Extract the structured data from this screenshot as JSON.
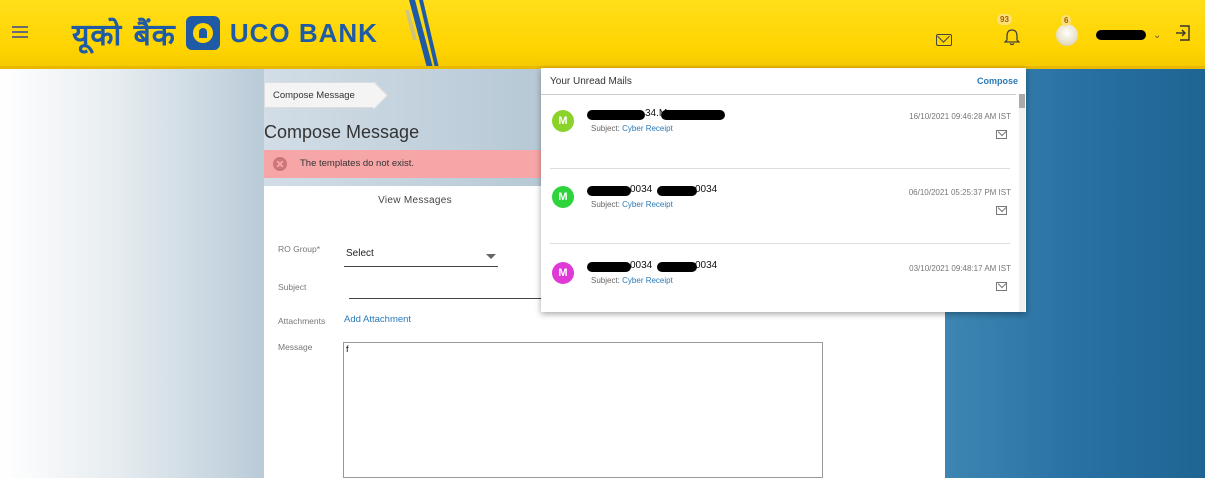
{
  "header": {
    "logo_hindi": "यूको बैंक",
    "logo_text": "UCO BANK",
    "notif_count": "93",
    "avatar_badge": "6",
    "dropdown_chevron": "⌄"
  },
  "breadcrumb": "Compose Message",
  "page_title": "Compose Message",
  "alert": "The templates do not exist.",
  "form": {
    "tab_label": "View Messages",
    "ro_group_label": "RO Group*",
    "ro_group_value": "Select",
    "subject_label": "Subject",
    "attachments_label": "Attachments",
    "add_attachment": "Add Attachment",
    "message_label": "Message",
    "message_value": "f"
  },
  "unread": {
    "title": "Your Unread Mails",
    "compose": "Compose",
    "subject_prefix": "Subject:",
    "mails": [
      {
        "initial": "M",
        "color": "#8bd32a",
        "sender_a": "34.M",
        "sender_b": "",
        "subject": "Cyber Receipt",
        "time": "16/10/2021 09:46:28 AM IST"
      },
      {
        "initial": "M",
        "color": "#2ed43b",
        "sender_a": "0034",
        "sender_b": "0034",
        "subject": "Cyber Receipt",
        "time": "06/10/2021 05:25:37 PM IST"
      },
      {
        "initial": "M",
        "color": "#e03ad6",
        "sender_a": "0034",
        "sender_b": "0034",
        "subject": "Cyber Receipt",
        "time": "03/10/2021 09:48:17 AM IST"
      }
    ]
  },
  "colors": {
    "header": "#ffd400",
    "brand_blue": "#1f5aa6",
    "link": "#2a7ab8",
    "alert_bg": "#f7a6a8"
  },
  "icons": [
    "menu-icon",
    "mail-icon",
    "bell-icon",
    "logout-icon",
    "close-circle-icon",
    "envelope-small-icon"
  ]
}
